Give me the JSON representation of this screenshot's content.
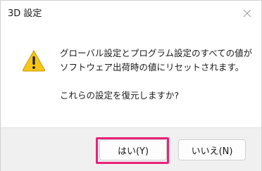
{
  "dialog": {
    "title": "3D 設定",
    "close_icon": "close-icon",
    "message_line1": "グローバル設定とプログラム設定のすべての値が",
    "message_line2": "ソフトウェア出荷時の値にリセットされます。",
    "question": "これらの設定を復元しますか?",
    "warning_icon": "warning-icon",
    "buttons": {
      "yes_label": "はい(Y)",
      "no_label": "いいえ(N)"
    }
  },
  "colors": {
    "highlight": "#e8237a",
    "warning_fill": "#f5c518"
  }
}
